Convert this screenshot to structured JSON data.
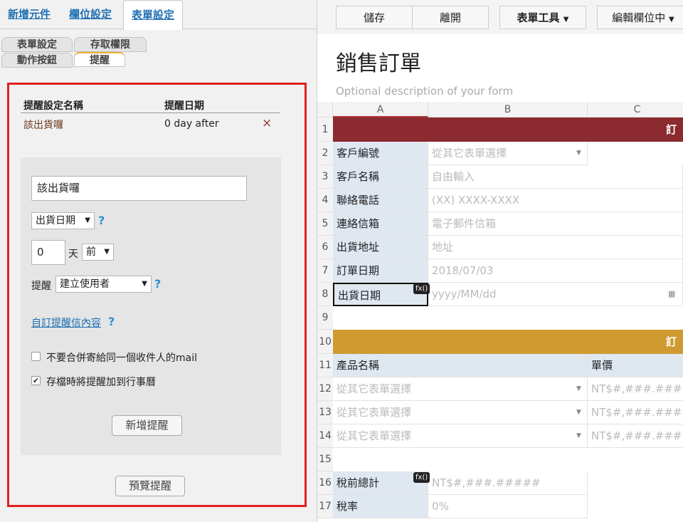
{
  "left_panel": {
    "top_tabs": [
      "新增元件",
      "欄位設定",
      "表單設定"
    ],
    "sub_tabs_row1": [
      "表單設定",
      "存取權限"
    ],
    "sub_tabs_row2": [
      "動作按鈕",
      "提醒"
    ],
    "reminder_table": {
      "headers": [
        "提醒設定名稱",
        "提醒日期"
      ],
      "rows": [
        {
          "name": "該出貨囉",
          "date": "0 day after",
          "remove": "×"
        }
      ]
    },
    "editor": {
      "name_value": "該出貨囉",
      "date_field_select": "出貨日期",
      "offset_value": "0",
      "unit_label": "天",
      "direction_select": "前",
      "remind_label": "提醒",
      "recipient_select": "建立使用者",
      "help": "?",
      "custom_mail_link": "自訂提醒信內容",
      "no_merge_label": "不要合併寄給同一個收件人的mail",
      "no_merge_checked": false,
      "add_calendar_label": "存檔時將提醒加到行事曆",
      "add_calendar_checked": true,
      "add_button": "新增提醒"
    },
    "preview_button": "預覽提醒"
  },
  "toolbar": {
    "save": "儲存",
    "leave": "離開",
    "form_tools": "表單工具",
    "edit_field": "編輯欄位中"
  },
  "form": {
    "title": "銷售訂單",
    "description_placeholder": "Optional description of your form"
  },
  "sheet": {
    "columns": [
      "A",
      "B",
      "C"
    ],
    "row_numbers": [
      "1",
      "2",
      "3",
      "4",
      "5",
      "6",
      "7",
      "8",
      "9",
      "10",
      "11",
      "12",
      "13",
      "14",
      "15",
      "16",
      "17"
    ],
    "section1_title": "訂",
    "section2_title": "訂",
    "section1_color": "#8b2a2f",
    "section2_color": "#cf9b31",
    "labels": {
      "r2": "客戶編號",
      "r3": "客戶名稱",
      "r4": "聯絡電話",
      "r5": "連絡信箱",
      "r6": "出貨地址",
      "r7": "訂單日期",
      "r8": "出貨日期",
      "r11a": "產品名稱",
      "r11c": "單價",
      "r16": "稅前總計",
      "r17": "稅率"
    },
    "placeholders": {
      "r2": "從其它表單選擇",
      "r3": "自由輸入",
      "r4": "(XX) XXXX-XXXX",
      "r5": "電子郵件信箱",
      "r6": "地址",
      "r7": "2018/07/03",
      "r8": "yyyy/MM/dd",
      "r12a": "從其它表單選擇",
      "r13a": "從其它表單選擇",
      "r14a": "從其它表單選擇",
      "r12c": "NT$#,###.#####",
      "r13c": "NT$#,###.#####",
      "r14c": "NT$#,###.#####",
      "r16": "NT$#,###.#####",
      "r17": "0%"
    },
    "fx_badge": "fx()"
  }
}
